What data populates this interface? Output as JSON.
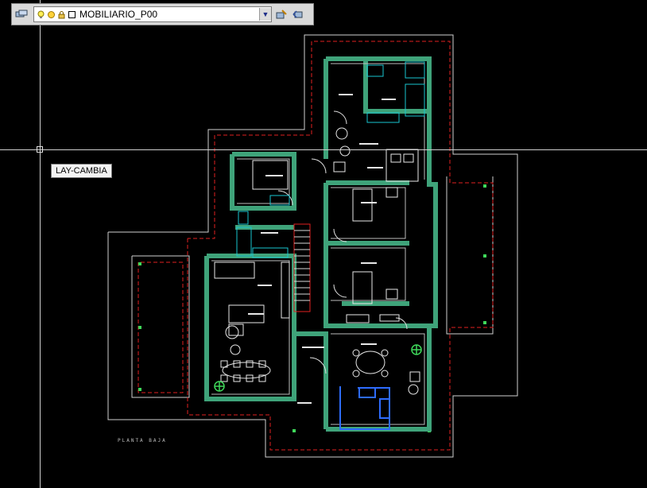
{
  "toolbar": {
    "layer_name": "MOBILIARIO_P00",
    "icons": [
      "layer-manager-icon",
      "lightbulb-icon",
      "sun-icon",
      "lock-icon",
      "color-swatch-icon",
      "make-current-icon",
      "previous-layer-icon"
    ]
  },
  "tooltip": {
    "text": "LAY-CAMBIA"
  },
  "drawing": {
    "plan_label": "PLANTA BAJA",
    "colors": {
      "background": "#000000",
      "walls": "#3fa37a",
      "outline": "#cfcfcf",
      "boundary": "#e02020",
      "furniture": "#e8e8e8",
      "fixtures": "#19c6d0",
      "kitchen": "#2e6cff"
    }
  }
}
